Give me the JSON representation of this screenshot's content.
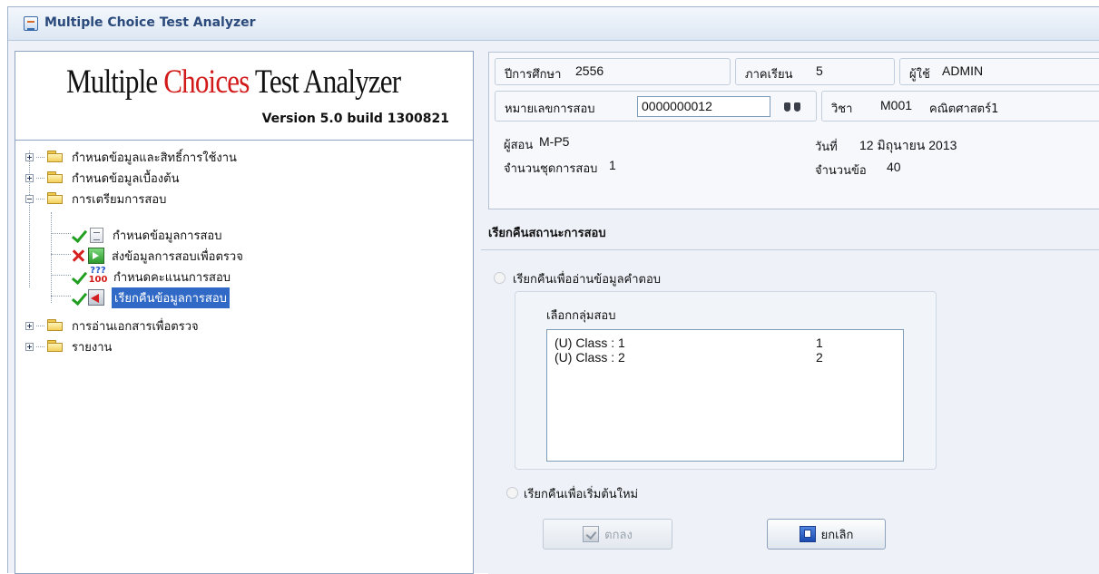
{
  "window": {
    "title": "Multiple Choice Test Analyzer",
    "icon": "app-icon"
  },
  "logo": {
    "word1": "Multiple",
    "word2": "Choices",
    "word3": "Test Analyzer",
    "version": "Version 5.0  build 1300821",
    "accent_color": "#d31a1a"
  },
  "tree": {
    "items": [
      {
        "label": "กำหนดข้อมูลและสิทธิ์การใช้งาน",
        "expander": "plus",
        "icon": "folder-icon"
      },
      {
        "label": "กำหนดข้อมูลเบื้องต้น",
        "expander": "plus",
        "icon": "folder-icon"
      },
      {
        "label": "การเตรียมการสอบ",
        "expander": "minus",
        "icon": "folder-icon"
      },
      {
        "label": "การอ่านเอกสารเพื่อตรวจ",
        "expander": "plus",
        "icon": "folder-icon"
      },
      {
        "label": "รายงาน",
        "expander": "plus",
        "icon": "folder-icon"
      }
    ],
    "children": [
      {
        "label": "กำหนดข้อมูลการสอบ",
        "status": "check-icon",
        "icon": "document-icon"
      },
      {
        "label": "ส่งข้อมูลการสอบเพื่อตรวจ",
        "status": "cross-icon",
        "icon": "send-icon"
      },
      {
        "label": "กำหนดคะแนนการสอบ",
        "status": "check-icon",
        "icon": "score-icon",
        "icon_top": "???",
        "icon_bottom": "100"
      },
      {
        "label": "เรียกคืนข้อมูลการสอบ",
        "status": "check-icon",
        "icon": "restore-icon",
        "selected": true
      }
    ]
  },
  "info": {
    "year_label": "ปีการศึกษา",
    "year_value": "2556",
    "term_label": "ภาคเรียน",
    "term_value": "5",
    "user_label": "ผู้ใช้",
    "user_value": "ADMIN",
    "exam_no_label": "หมายเลขการสอบ",
    "exam_no_value": "0000000012",
    "subject_label": "วิชา",
    "subject_code": "M001",
    "subject_name": "คณิตศาสตร์1",
    "examiner_label": "ผู้สอน",
    "examiner_value": "M-P5",
    "date_label": "วันที่",
    "date_value": "12 มิถุนายน 2013",
    "sets_label": "จำนวนชุดการสอบ",
    "sets_value": "1",
    "items_label": "จำนวนข้อ",
    "items_value": "40"
  },
  "main": {
    "section_title": "เรียกคืนสถานะการสอบ",
    "option1_label": "เรียกคืนเพื่ออ่านข้อมูลคำตอบ",
    "group_label": "เลือกกลุ่มสอบ",
    "groups": [
      {
        "name": "(U) Class : 1",
        "number": "1"
      },
      {
        "name": "(U) Class : 2",
        "number": "2"
      }
    ],
    "option2_label": "เรียกคืนเพื่อเริ่มต้นใหม่",
    "ok_label": "ตกลง",
    "cancel_label": "ยกเลิก"
  }
}
